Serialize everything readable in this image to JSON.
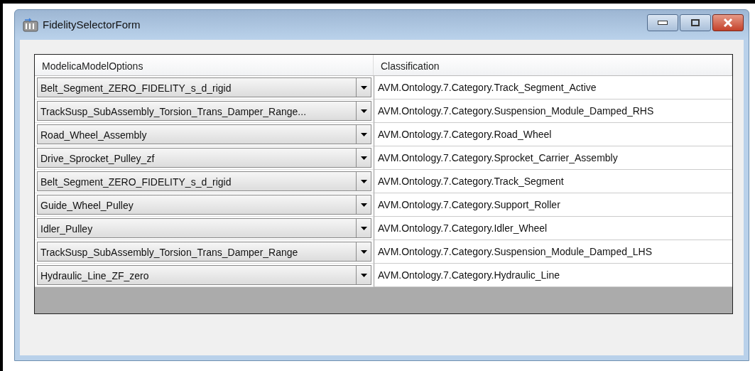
{
  "window": {
    "title": "FidelitySelectorForm"
  },
  "table": {
    "columns": [
      "ModelicaModelOptions",
      "Classification"
    ],
    "rows": [
      {
        "option": "Belt_Segment_ZERO_FIDELITY_s_d_rigid",
        "classification": "AVM.Ontology.7.Category.Track_Segment_Active"
      },
      {
        "option": "TrackSusp_SubAssembly_Torsion_Trans_Damper_Range...",
        "classification": "AVM.Ontology.7.Category.Suspension_Module_Damped_RHS"
      },
      {
        "option": "Road_Wheel_Assembly",
        "classification": "AVM.Ontology.7.Category.Road_Wheel"
      },
      {
        "option": "Drive_Sprocket_Pulley_zf",
        "classification": "AVM.Ontology.7.Category.Sprocket_Carrier_Assembly"
      },
      {
        "option": "Belt_Segment_ZERO_FIDELITY_s_d_rigid",
        "classification": "AVM.Ontology.7.Category.Track_Segment"
      },
      {
        "option": "Guide_Wheel_Pulley",
        "classification": "AVM.Ontology.7.Category.Support_Roller"
      },
      {
        "option": "Idler_Pulley",
        "classification": "AVM.Ontology.7.Category.Idler_Wheel"
      },
      {
        "option": "TrackSusp_SubAssembly_Torsion_Trans_Damper_Range",
        "classification": "AVM.Ontology.7.Category.Suspension_Module_Damped_LHS"
      },
      {
        "option": "Hydraulic_Line_ZF_zero",
        "classification": "AVM.Ontology.7.Category.Hydraulic_Line"
      }
    ]
  }
}
